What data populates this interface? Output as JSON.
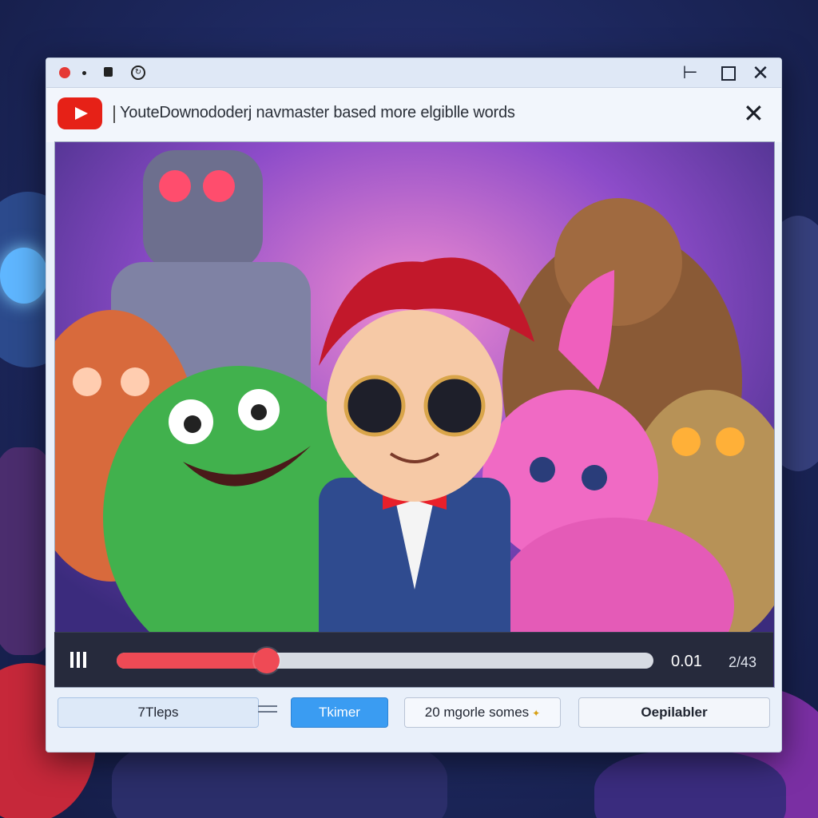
{
  "window": {
    "title_bar": {
      "min_glyph": "⊢",
      "close_glyph": "✕"
    },
    "address": {
      "text": "YouteDownododerj navmaster based more elgiblle words",
      "close_glyph": "✕"
    }
  },
  "player": {
    "progress": 0.28,
    "time_current": "0.01",
    "time_total": "2/43"
  },
  "buttons": [
    {
      "label": "7Tleps"
    },
    {
      "label": "Tkimer"
    },
    {
      "label": "20 mgorle somes",
      "icon": "sparkle-icon",
      "icon_glyph": "✦"
    },
    {
      "label": "Oepilabler"
    }
  ],
  "colors": {
    "accent_red": "#ef4a55",
    "accent_blue": "#3a9cf2",
    "youtube_red": "#e62117"
  }
}
